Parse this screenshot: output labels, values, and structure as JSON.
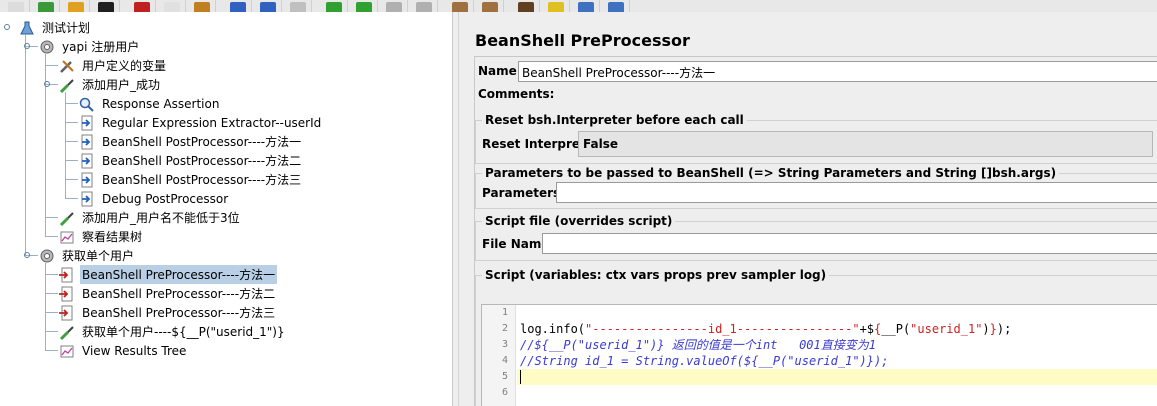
{
  "toolbar": {
    "buttons": [
      "new",
      "templates",
      "open",
      "save",
      "cut",
      "copy",
      "paste",
      "expand",
      "collapse",
      "toggle",
      "start",
      "start-no-pause",
      "stop",
      "shutdown",
      "clear",
      "clear-all",
      "search",
      "reset-search",
      "function-helper",
      "help"
    ]
  },
  "tree": {
    "items": [
      {
        "label": "测试计划",
        "icon": "test-plan-icon",
        "level": 0,
        "selected": false
      },
      {
        "label": "yapi 注册用户",
        "icon": "thread-group-gear-icon",
        "level": 1,
        "selected": false
      },
      {
        "label": "用户定义的变量",
        "icon": "config-wrench-icon",
        "level": 2,
        "selected": false
      },
      {
        "label": "添加用户_成功",
        "icon": "sampler-pipette-icon",
        "level": 2,
        "selected": false
      },
      {
        "label": "Response Assertion",
        "icon": "magnifier-icon",
        "level": 3,
        "selected": false
      },
      {
        "label": "Regular Expression Extractor--userId",
        "icon": "postprocessor-arrow-icon",
        "level": 3,
        "selected": false
      },
      {
        "label": "BeanShell PostProcessor----方法一",
        "icon": "postprocessor-arrow-icon",
        "level": 3,
        "selected": false
      },
      {
        "label": "BeanShell PostProcessor----方法二",
        "icon": "postprocessor-arrow-icon",
        "level": 3,
        "selected": false
      },
      {
        "label": "BeanShell PostProcessor----方法三",
        "icon": "postprocessor-arrow-icon",
        "level": 3,
        "selected": false
      },
      {
        "label": "Debug PostProcessor",
        "icon": "postprocessor-arrow-icon",
        "level": 3,
        "selected": false
      },
      {
        "label": "添加用户_用户名不能低于3位",
        "icon": "sampler-pipette-icon",
        "level": 2,
        "selected": false
      },
      {
        "label": "察看结果树",
        "icon": "listener-graph-icon",
        "level": 2,
        "selected": false
      },
      {
        "label": "获取单个用户",
        "icon": "thread-group-gear-icon",
        "level": 1,
        "selected": false
      },
      {
        "label": "BeanShell PreProcessor----方法一",
        "icon": "preprocessor-arrow-icon",
        "level": 2,
        "selected": true
      },
      {
        "label": "BeanShell PreProcessor----方法二",
        "icon": "preprocessor-arrow-icon",
        "level": 2,
        "selected": false
      },
      {
        "label": "BeanShell PreProcessor----方法三",
        "icon": "preprocessor-arrow-icon",
        "level": 2,
        "selected": false
      },
      {
        "label": "获取单个用户----${__P(\"userid_1\")}",
        "icon": "sampler-pipette-icon",
        "level": 2,
        "selected": false
      },
      {
        "label": "View Results Tree",
        "icon": "listener-graph-icon",
        "level": 2,
        "selected": false
      }
    ]
  },
  "editor_panel": {
    "title": "BeanShell PreProcessor",
    "name_label": "Name:",
    "name_value": "BeanShell PreProcessor----方法一",
    "comments_label": "Comments:",
    "reset_group_title": "Reset bsh.Interpreter before each call",
    "reset_label": "Reset Interpreter:",
    "reset_value": "False",
    "params_group_title": "Parameters to be passed to BeanShell (=> String Parameters and String []bsh.args)",
    "params_label": "Parameters:",
    "params_value": "",
    "file_group_title": "Script file (overrides script)",
    "file_label": "File Name:",
    "file_value": "",
    "script_group_title": "Script (variables: ctx vars props prev sampler log)",
    "line_numbers": [
      "1",
      "2",
      "3",
      "4",
      "5",
      "6"
    ],
    "code_lines": [
      "",
      "log.info(\"----------------id_1----------------\"+${__P(\"userid_1\")});",
      "//${__P(\"userid_1\")} 返回的值是一个int   001直接变为1",
      "//String id_1 = String.valueOf(${__P(\"userid_1\")});",
      "",
      ""
    ],
    "code_line_2_parts": [
      "log.info(",
      "\"----------------id_1----------------\"",
      "+$",
      "{",
      "__P(",
      "\"userid_1\"",
      ")",
      "}",
      ");"
    ]
  },
  "colors": {
    "selection": "#b8cfe5",
    "current_line": "#fefbc5",
    "string": "#d02020",
    "comment": "#3a3ad0"
  }
}
